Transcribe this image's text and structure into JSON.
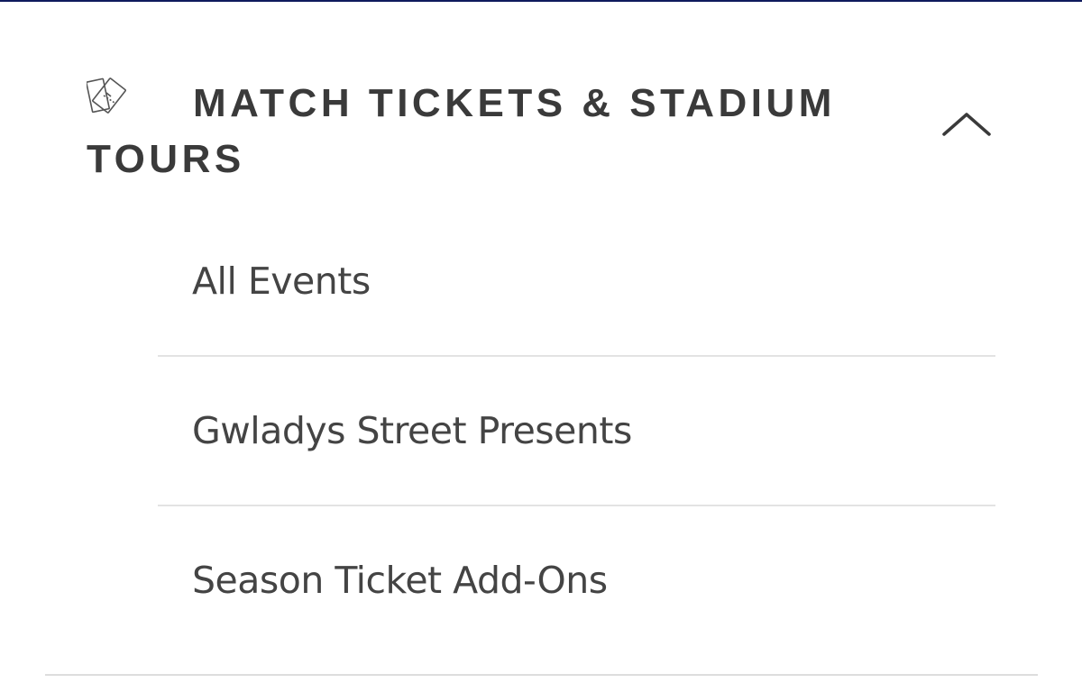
{
  "section": {
    "title": "MATCH TICKETS & STADIUM TOURS",
    "icon": "ticket-icon",
    "toggle_icon": "chevron-up-icon",
    "expanded": true
  },
  "submenu": {
    "items": [
      {
        "label": "All Events"
      },
      {
        "label": "Gwladys Street Presents"
      },
      {
        "label": "Season Ticket Add-Ons"
      }
    ]
  },
  "colors": {
    "top_rule": "#0e1a5c",
    "title_text": "#3a3a3a",
    "item_text": "#444444",
    "divider": "#e3e3e3"
  }
}
